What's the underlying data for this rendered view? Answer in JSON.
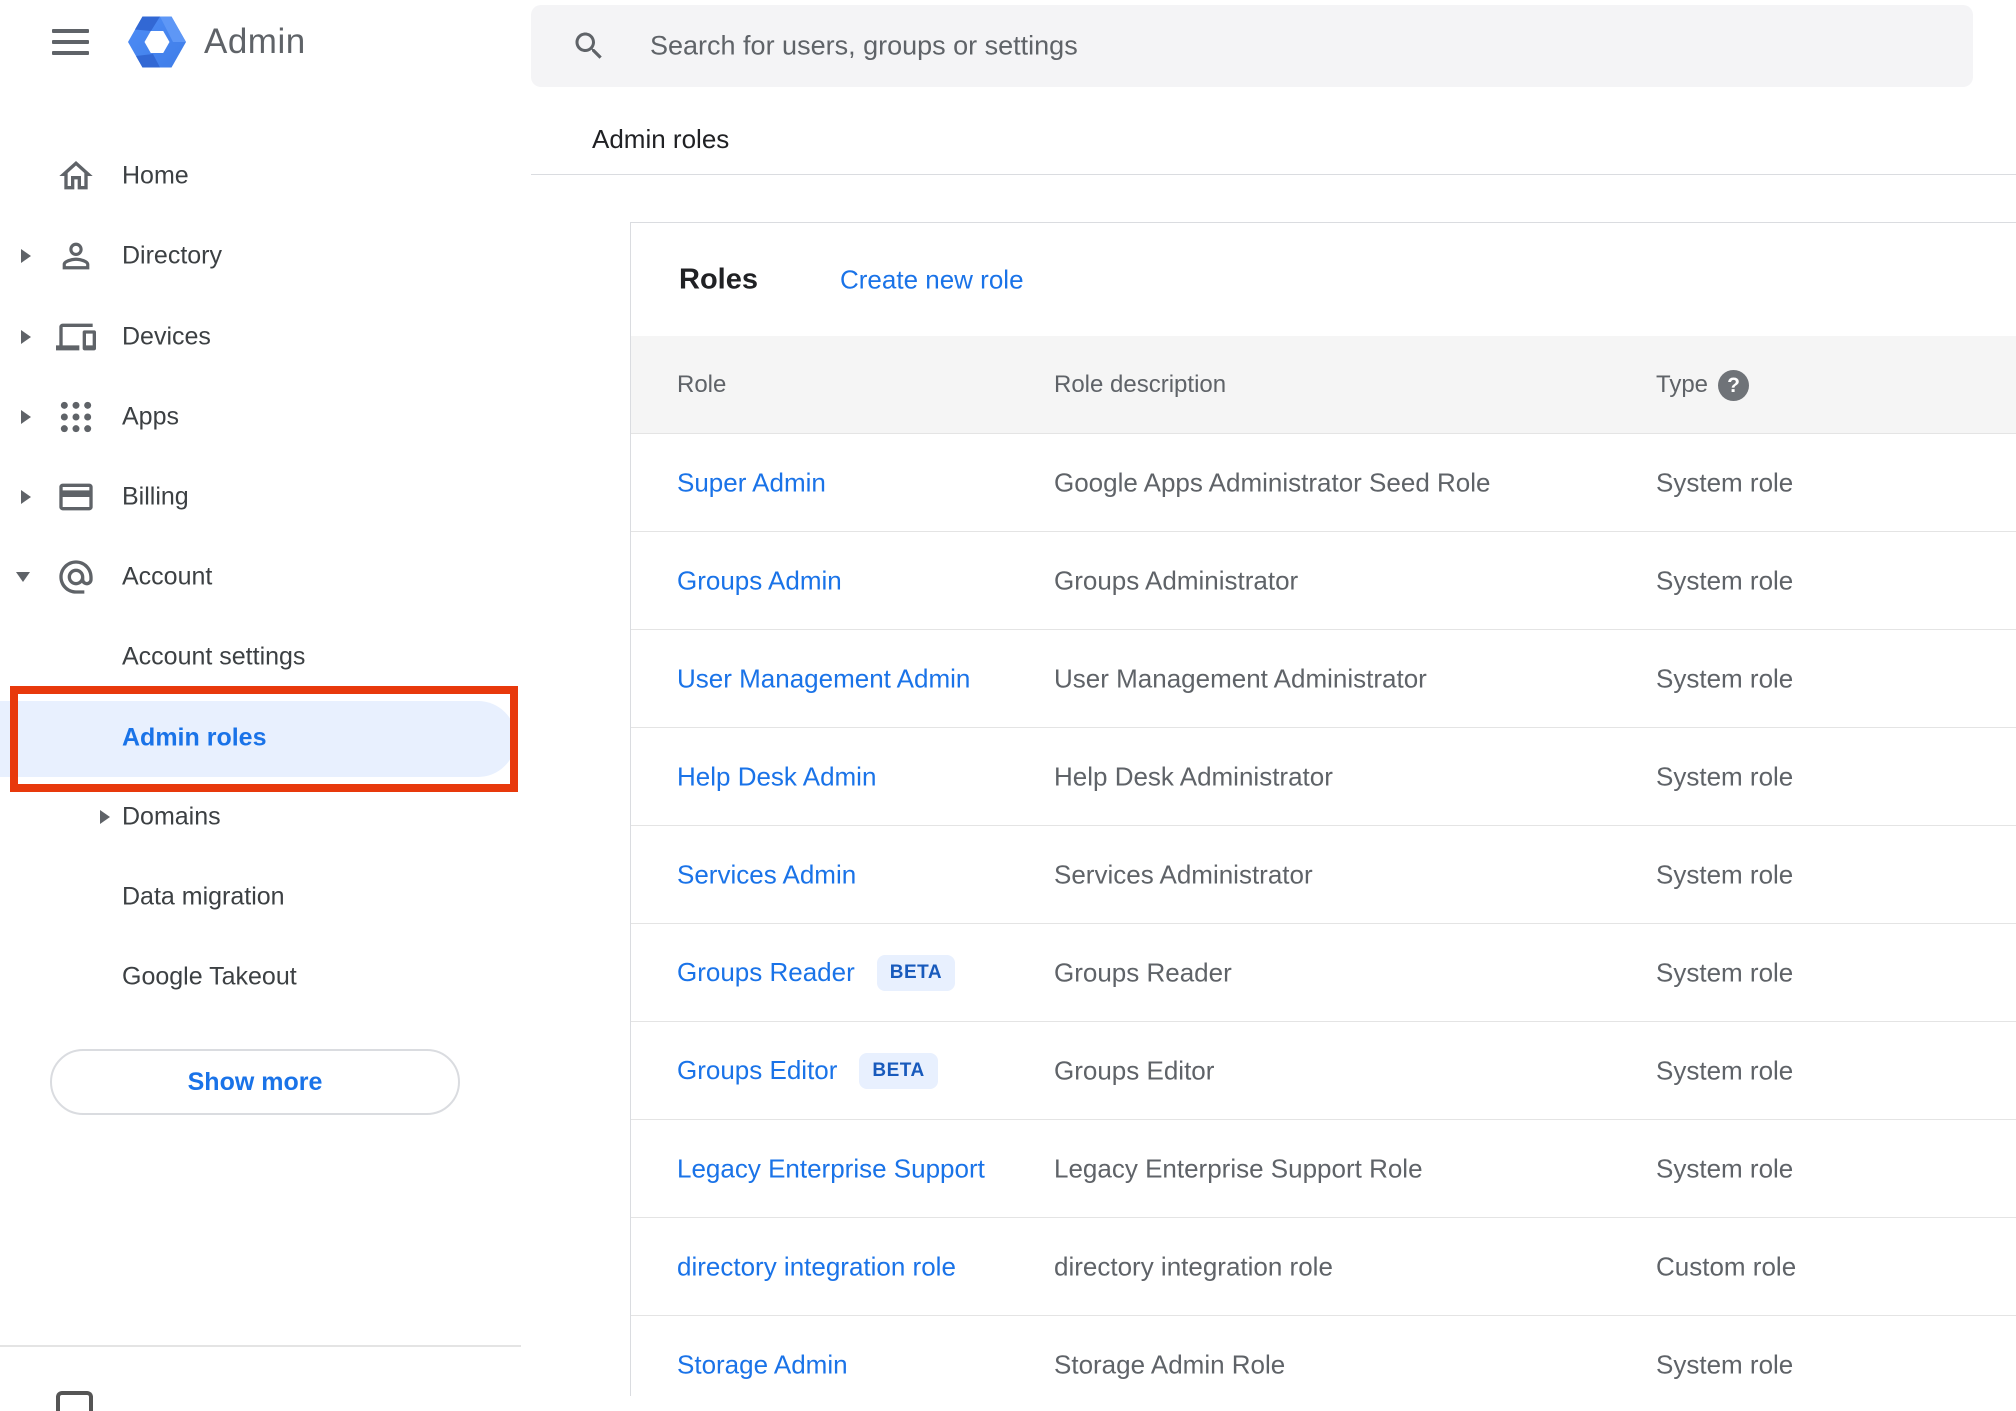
{
  "app": {
    "product_name": "Admin"
  },
  "search": {
    "placeholder": "Search for users, groups or settings"
  },
  "breadcrumb": "Admin roles",
  "sidebar": {
    "items": [
      {
        "label": "Home"
      },
      {
        "label": "Directory"
      },
      {
        "label": "Devices"
      },
      {
        "label": "Apps"
      },
      {
        "label": "Billing"
      },
      {
        "label": "Account"
      },
      {
        "label": "Account settings"
      },
      {
        "label": "Admin roles",
        "selected": true,
        "annotated": true
      },
      {
        "label": "Domains"
      },
      {
        "label": "Data migration"
      },
      {
        "label": "Google Takeout"
      }
    ],
    "show_more_label": "Show more"
  },
  "main": {
    "title": "Roles",
    "create_link": "Create new role",
    "table": {
      "headers": {
        "role": "Role",
        "description": "Role description",
        "type": "Type"
      },
      "rows": [
        {
          "role": "Super Admin",
          "description": "Google Apps Administrator Seed Role",
          "type": "System role"
        },
        {
          "role": "Groups Admin",
          "description": "Groups Administrator",
          "type": "System role"
        },
        {
          "role": "User Management Admin",
          "description": "User Management Administrator",
          "type": "System role"
        },
        {
          "role": "Help Desk Admin",
          "description": "Help Desk Administrator",
          "type": "System role"
        },
        {
          "role": "Services Admin",
          "description": "Services Administrator",
          "type": "System role"
        },
        {
          "role": "Groups Reader",
          "badge": "BETA",
          "description": "Groups Reader",
          "type": "System role"
        },
        {
          "role": "Groups Editor",
          "badge": "BETA",
          "description": "Groups Editor",
          "type": "System role"
        },
        {
          "role": "Legacy Enterprise Support",
          "description": "Legacy Enterprise Support Role",
          "type": "System role"
        },
        {
          "role": "directory integration role",
          "description": "directory integration role",
          "type": "Custom role"
        },
        {
          "role": "Storage Admin",
          "description": "Storage Admin Role",
          "type": "System role"
        }
      ]
    }
  },
  "icons": {
    "hamburger": "menu-icon",
    "logo": "admin-hexagon-logo",
    "search": "search-icon",
    "home": "home-icon",
    "directory": "person-icon",
    "devices": "devices-icon",
    "apps": "apps-grid-icon",
    "billing": "credit-card-icon",
    "account": "at-sign-icon",
    "type_help": "help-question-icon"
  },
  "colors": {
    "link_blue": "#1a73e8",
    "selected_bg": "#e8f0fe",
    "annotation_red": "#e8390c",
    "badge_bg": "#e8f0fe",
    "badge_text": "#185abc",
    "icon_gray": "#5f6368",
    "header_bg": "#f5f5f5",
    "divider": "#dadce0",
    "search_bg": "#f4f4f6"
  }
}
